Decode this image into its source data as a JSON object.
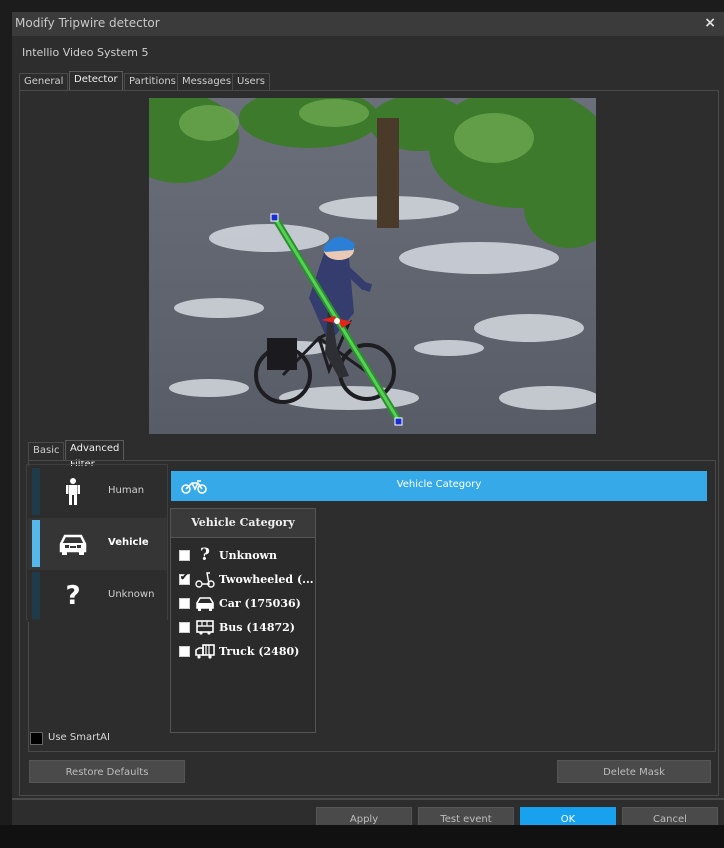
{
  "window": {
    "title": "Modify Tripwire detector",
    "close_glyph": "×",
    "subtitle": "Intellio Video System 5"
  },
  "tabs": [
    {
      "label": "General"
    },
    {
      "label": "Detector",
      "active": true
    },
    {
      "label": "Partitions"
    },
    {
      "label": "Messages"
    },
    {
      "label": "Users"
    }
  ],
  "subtabs": [
    {
      "label": "Basic"
    },
    {
      "label": "Advanced Filter",
      "active": true
    }
  ],
  "classes": [
    {
      "label": "Human",
      "icon": "human-icon",
      "active": false
    },
    {
      "label": "Vehicle",
      "icon": "car-icon",
      "active": true
    },
    {
      "label": "Unknown",
      "icon": "question-icon",
      "active": false
    }
  ],
  "category_header": {
    "label": "Vehicle Category",
    "icon": "motorbike-icon"
  },
  "dropdown": {
    "title": "Vehicle Category",
    "items": [
      {
        "label": "Unknown",
        "icon": "question-icon",
        "checked": false
      },
      {
        "label": "Twowheeled (...",
        "icon": "scooter-icon",
        "checked": true
      },
      {
        "label": "Car (175036)",
        "icon": "car-icon",
        "checked": false
      },
      {
        "label": "Bus (14872)",
        "icon": "bus-icon",
        "checked": false
      },
      {
        "label": "Truck (2480)",
        "icon": "truck-icon",
        "checked": false
      }
    ]
  },
  "smart_ai": {
    "label": "Use SmartAI",
    "checked": false
  },
  "buttons": {
    "restore_defaults": "Restore Defaults",
    "delete_mask": "Delete Mask",
    "apply": "Apply",
    "test_event": "Test event",
    "ok": "OK",
    "cancel": "Cancel"
  },
  "colors": {
    "accent": "#36a9e8",
    "primary_button": "#18a1ee",
    "tripwire": "#3cc23c",
    "tripwire_arrow": "#e0251b",
    "handle": "#1a2bd4"
  }
}
